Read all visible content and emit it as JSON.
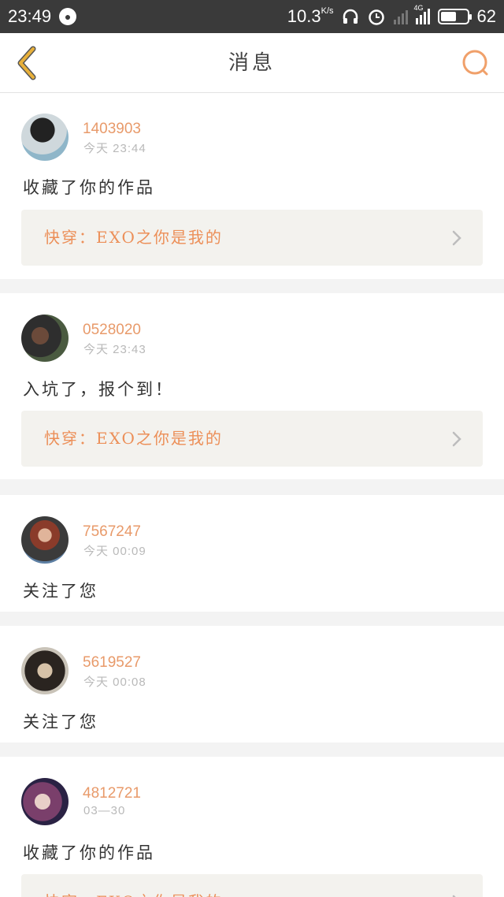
{
  "status_bar": {
    "time": "23:49",
    "speed": "10.3",
    "speed_unit": "K/s",
    "network": "4G",
    "battery": "62",
    "battery_level": 0.62
  },
  "header": {
    "title": "消息",
    "back_icon": "chevron-left-icon",
    "search_icon": "search-icon",
    "accent_color": "#e8b03a",
    "search_color": "#f0a06a"
  },
  "messages": [
    {
      "username": "1403903",
      "time": "今天  23:44",
      "text": "收藏了你的作品",
      "work": "快穿：EXO之你是我的"
    },
    {
      "username": "0528020",
      "time": "今天  23:43",
      "text": "入坑了，报个到！",
      "work": "快穿：EXO之你是我的"
    },
    {
      "username": "7567247",
      "time": "今天  00:09",
      "text": "关注了您"
    },
    {
      "username": "5619527",
      "time": "今天  00:08",
      "text": "关注了您"
    },
    {
      "username": "4812721",
      "time": "03—30",
      "text": "收藏了你的作品",
      "work": "快穿：EXO之你是我的"
    }
  ]
}
